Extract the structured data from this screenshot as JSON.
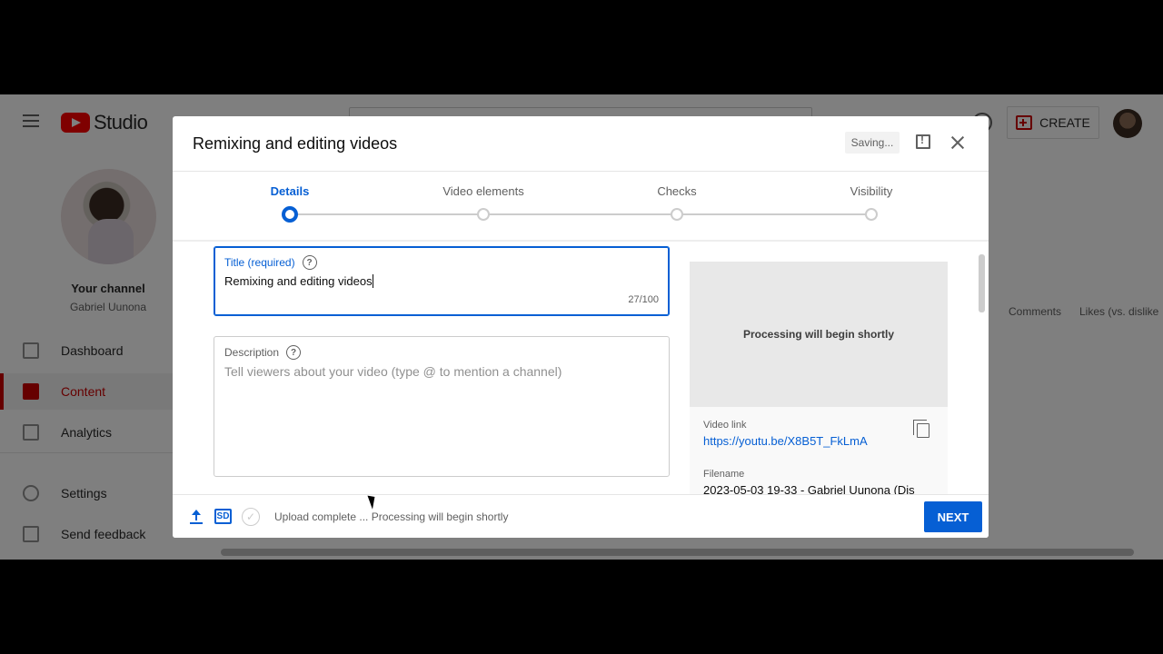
{
  "app": {
    "logo_text": "Studio",
    "create_label": "CREATE"
  },
  "sidebar": {
    "your_channel": "Your channel",
    "channel_name": "Gabriel Uunona",
    "items": [
      {
        "label": "Dashboard",
        "icon": "dashboard-icon"
      },
      {
        "label": "Content",
        "icon": "content-icon",
        "active": true
      },
      {
        "label": "Analytics",
        "icon": "analytics-icon"
      },
      {
        "label": "Settings",
        "icon": "gear-icon"
      },
      {
        "label": "Send feedback",
        "icon": "feedback-icon"
      }
    ]
  },
  "background_columns": [
    "Comments",
    "Likes (vs. dislike"
  ],
  "dialog": {
    "title": "Remixing and editing videos",
    "saving": "Saving...",
    "steps": [
      {
        "label": "Details",
        "active": true
      },
      {
        "label": "Video elements"
      },
      {
        "label": "Checks"
      },
      {
        "label": "Visibility"
      }
    ],
    "title_field": {
      "label": "Title (required)",
      "value": "Remixing and editing videos",
      "count": "27/100"
    },
    "description_field": {
      "label": "Description",
      "placeholder": "Tell viewers about your video (type @ to mention a channel)"
    },
    "preview": {
      "processing": "Processing will begin shortly",
      "video_link_label": "Video link",
      "video_link": "https://youtu.be/X8B5T_FkLmA",
      "filename_label": "Filename",
      "filename": "2023-05-03 19-33 - Gabriel Uunona (Dis"
    },
    "footer": {
      "sd_badge": "SD",
      "status": "Upload complete ... Processing will begin shortly",
      "next_label": "NEXT"
    }
  },
  "colors": {
    "accent": "#065fd4",
    "brand_red": "#ff0000"
  }
}
